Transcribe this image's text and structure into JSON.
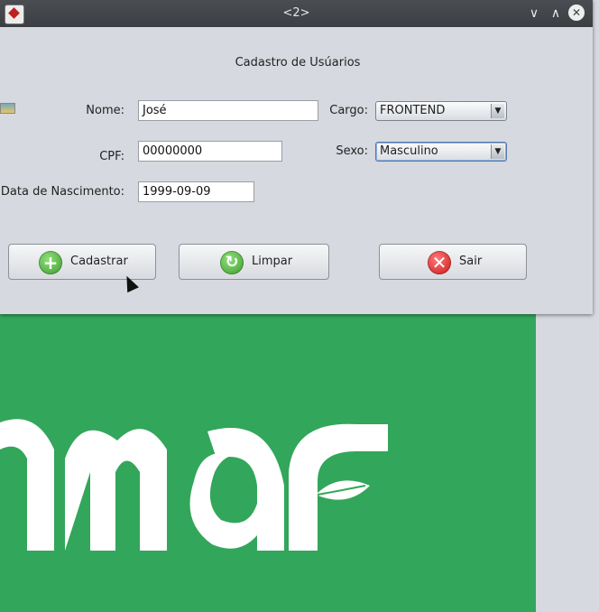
{
  "window": {
    "title": "<2>",
    "controls": {
      "minimize": "∨",
      "maximize": "∧",
      "close": "✕"
    }
  },
  "form": {
    "heading": "Cadastro de Usúarios",
    "nome_label": "Nome:",
    "nome_value": "José",
    "cpf_label": "CPF:",
    "cpf_value": "00000000",
    "data_label": "Data de Nascimento:",
    "data_value": "1999-09-09",
    "cargo_label": "Cargo:",
    "cargo_value": "FRONTEND",
    "sexo_label": "Sexo:",
    "sexo_value": "Masculino"
  },
  "buttons": {
    "cadastrar": "Cadastrar",
    "limpar": "Limpar",
    "sair": "Sair"
  },
  "icons": {
    "cadastrar": "plus-icon",
    "limpar": "refresh-icon",
    "sair": "close-icon"
  },
  "colors": {
    "background_green": "#32a65a",
    "titlebar": "#3b3e42",
    "window_bg": "#d6d9df"
  }
}
